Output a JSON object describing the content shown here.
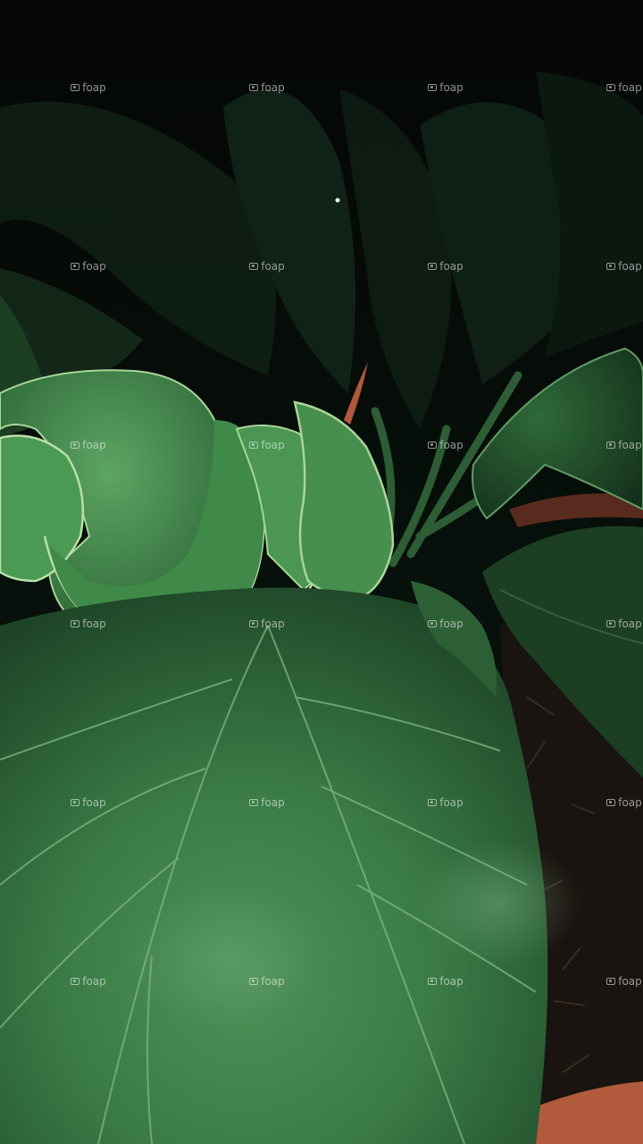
{
  "watermark": {
    "text": "foap",
    "columns": 4,
    "rows": 7
  },
  "colors": {
    "background": "#050807",
    "leaf_light": "#4f9a56",
    "leaf_mid": "#2f6b3a",
    "leaf_dark": "#12271a",
    "leaf_edge": "#a9d59a",
    "soil": "#1a1410",
    "pot": "#b25a3c"
  },
  "icons": {
    "watermark_mark": "camera-icon"
  }
}
